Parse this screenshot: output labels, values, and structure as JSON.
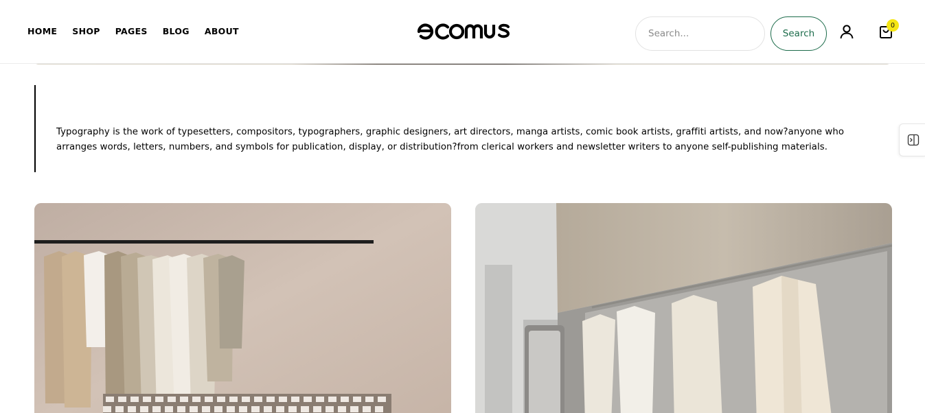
{
  "header": {
    "nav": [
      "HOME",
      "SHOP",
      "PAGES",
      "BLOG",
      "ABOUT"
    ],
    "logo_text": "ecomus",
    "search_placeholder": "Search...",
    "search_button": "Search",
    "cart_count": "0"
  },
  "quote": {
    "text": "Typography is the work of typesetters, compositors, typographers, graphic designers, art directors, manga artists, comic book artists, graffiti artists, and now?anyone who arranges words, letters, numbers, and symbols for publication, display, or distribution?from clerical workers and newsletter writers to anyone self-publishing materials."
  },
  "icons": {
    "user": "user-icon",
    "cart": "shopping-bag-icon",
    "side_widget": "sidebar-toggle-icon"
  },
  "colors": {
    "accent": "#1b6b4a",
    "badge": "#f5e614"
  }
}
